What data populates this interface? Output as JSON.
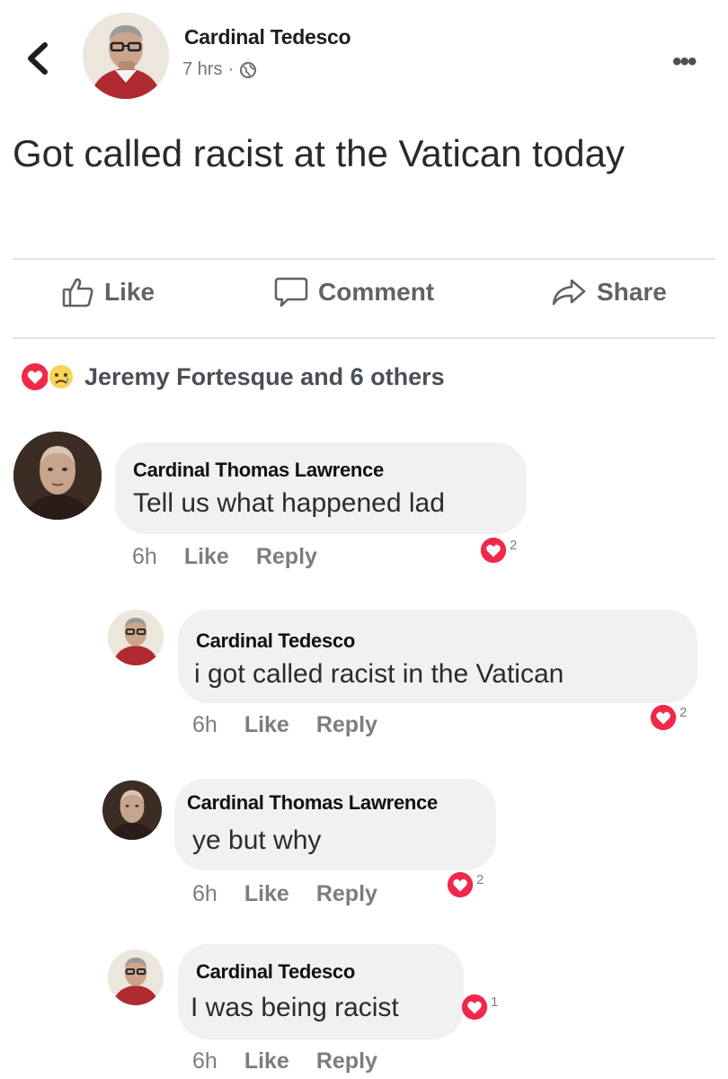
{
  "post": {
    "author": "Cardinal Tedesco",
    "time": "7 hrs",
    "separator": "·",
    "text": "Got called racist at the Vatican today",
    "actions": {
      "like": "Like",
      "comment": "Comment",
      "share": "Share"
    },
    "reactions_summary": "Jeremy Fortesque and 6 others"
  },
  "comments": [
    {
      "author": "Cardinal Thomas Lawrence",
      "text": "Tell us what happened lad",
      "time": "6h",
      "like": "Like",
      "reply": "Reply",
      "reactions": "2"
    },
    {
      "author": "Cardinal Tedesco",
      "text": "i got called racist in the Vatican",
      "time": "6h",
      "like": "Like",
      "reply": "Reply",
      "reactions": "2"
    },
    {
      "author": "Cardinal Thomas Lawrence",
      "text": "ye but why",
      "time": "6h",
      "like": "Like",
      "reply": "Reply",
      "reactions": "2"
    },
    {
      "author": "Cardinal Tedesco",
      "text": "I was being racist",
      "time": "6h",
      "like": "Like",
      "reply": "Reply",
      "reactions": "1"
    }
  ],
  "icons": [
    "back-chevron-icon",
    "globe-icon",
    "more-icon",
    "thumbs-up-icon",
    "comment-icon",
    "share-icon",
    "love-reaction-icon",
    "sad-reaction-icon"
  ],
  "colors": {
    "love_red": "#f0284a",
    "sad_yellow": "#f7d35a",
    "bubble_gray": "#f0f1f3",
    "meta_gray": "#7a7d82"
  }
}
